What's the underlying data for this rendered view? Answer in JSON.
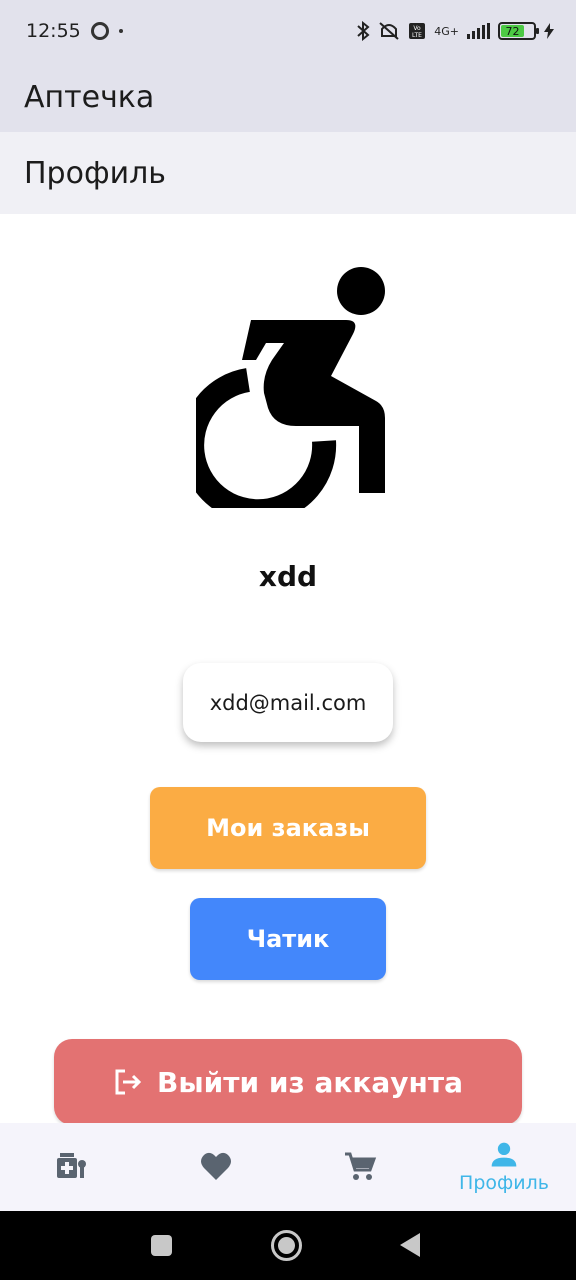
{
  "status_bar": {
    "time": "12:55",
    "network": "4G+",
    "battery_level": "72",
    "battery_fraction": 0.72
  },
  "app_bar": {
    "title": "Аптечка"
  },
  "page": {
    "title": "Профиль"
  },
  "profile": {
    "avatar_icon": "wheelchair-icon",
    "username": "xdd",
    "email": "xdd@mail.com"
  },
  "actions": {
    "orders_label": "Мои заказы",
    "chat_label": "Чатик",
    "logout_label": "Выйти из аккаунта",
    "orders_color": "#fbac44",
    "chat_color": "#4387fb",
    "logout_color": "#e37272"
  },
  "bottom_nav": {
    "items": [
      {
        "icon": "medical-services-icon",
        "label": ""
      },
      {
        "icon": "heart-icon",
        "label": ""
      },
      {
        "icon": "cart-icon",
        "label": ""
      },
      {
        "icon": "person-icon",
        "label": "Профиль",
        "active": true
      }
    ],
    "active_color": "#3fb6e8",
    "inactive_color": "#5a6470"
  }
}
